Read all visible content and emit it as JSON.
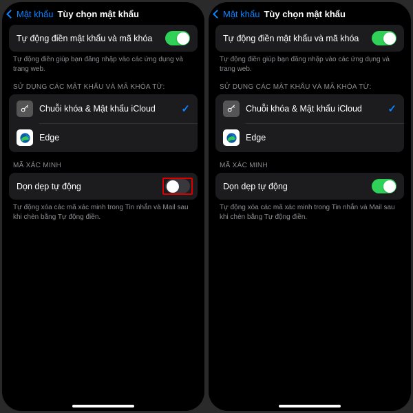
{
  "header": {
    "back_label": "Mật khẩu",
    "title": "Tùy chọn mật khẩu"
  },
  "autofill": {
    "label": "Tự động điền mật khẩu và mã khóa",
    "footer": "Tự động điền giúp bạn đăng nhập vào các ứng dụng và trang web."
  },
  "sources": {
    "header": "SỬ DỤNG CÁC MẬT KHẨU VÀ MÃ KHÓA TỪ:",
    "keychain": "Chuỗi khóa & Mật khẩu iCloud",
    "edge": "Edge"
  },
  "verify": {
    "header": "MÃ XÁC MINH",
    "cleanup": "Dọn dẹp tự động",
    "footer": "Tự động xóa các mã xác minh trong Tin nhắn và Mail sau khi chèn bằng Tự động điền."
  }
}
